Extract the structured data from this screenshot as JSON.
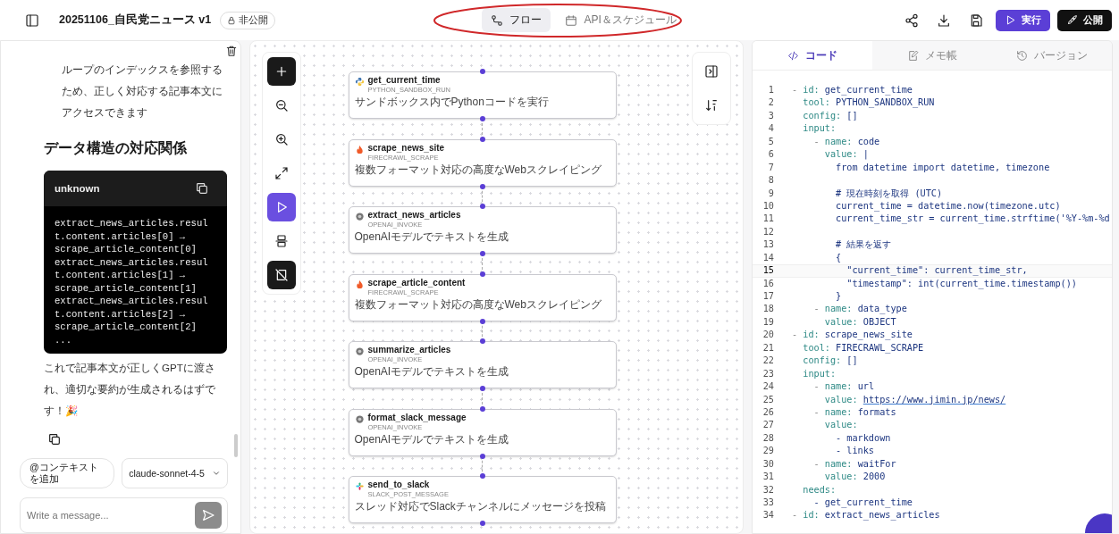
{
  "header": {
    "title": "20251106_自民党ニュース v1",
    "visibility": "非公開",
    "view_tabs": [
      {
        "label": "フロー",
        "kind": "flow",
        "selected": true
      },
      {
        "label": "API＆スケジュール",
        "kind": "calendar",
        "selected": false
      }
    ],
    "run_button": "実行",
    "publish_button": "公開"
  },
  "annotation": {
    "kind": "ellipse"
  },
  "chat": {
    "messages": [
      {
        "kind": "indented",
        "text": "ループのインデックスを参照するため、正しく対応する記事本文にアクセスできます"
      },
      {
        "kind": "heading",
        "text": "データ構造の対応関係"
      },
      {
        "kind": "code",
        "language": "unknown",
        "lines": [
          "extract_news_articles.result.content.articles[0] → scrape_article_content[0]",
          "extract_news_articles.result.content.articles[1] → scrape_article_content[1]",
          "extract_news_articles.result.content.articles[2] → scrape_article_content[2]",
          "..."
        ]
      },
      {
        "kind": "paragraph",
        "text": "これで記事本文が正しくGPTに渡され、適切な要約が生成されるはずです！🎉"
      }
    ],
    "context_button": "@コンテキストを追加",
    "model": "claude-sonnet-4-5",
    "message_placeholder": "Write a message..."
  },
  "canvas": {
    "tools": [
      {
        "kind": "add"
      },
      {
        "kind": "zoom-out"
      },
      {
        "kind": "zoom-in"
      },
      {
        "kind": "fit"
      },
      {
        "kind": "run"
      },
      {
        "kind": "layout"
      },
      {
        "kind": "hide"
      }
    ],
    "nodes": [
      {
        "name": "get_current_time",
        "tool": "PYTHON_SANDBOX_RUN",
        "description": "サンドボックス内でPythonコードを実行",
        "kind": "python"
      },
      {
        "name": "scrape_news_site",
        "tool": "FIRECRAWL_SCRAPE",
        "description": "複数フォーマット対応の高度なWebスクレイピング",
        "kind": "firecrawl"
      },
      {
        "name": "extract_news_articles",
        "tool": "OPENAI_INVOKE",
        "description": "OpenAIモデルでテキストを生成",
        "kind": "openai"
      },
      {
        "name": "scrape_article_content",
        "tool": "FIRECRAWL_SCRAPE",
        "description": "複数フォーマット対応の高度なWebスクレイピング",
        "kind": "firecrawl"
      },
      {
        "name": "summarize_articles",
        "tool": "OPENAI_INVOKE",
        "description": "OpenAIモデルでテキストを生成",
        "kind": "openai"
      },
      {
        "name": "format_slack_message",
        "tool": "OPENAI_INVOKE",
        "description": "OpenAIモデルでテキストを生成",
        "kind": "openai"
      },
      {
        "name": "send_to_slack",
        "tool": "SLACK_POST_MESSAGE",
        "description": "スレッド対応でSlackチャンネルにメッセージを投稿",
        "kind": "slack"
      }
    ]
  },
  "editor": {
    "tabs": [
      {
        "label": "コード",
        "kind": "code",
        "selected": true
      },
      {
        "label": "メモ帳",
        "kind": "notes",
        "selected": false
      },
      {
        "label": "バージョン",
        "kind": "history",
        "selected": false
      }
    ],
    "lines": [
      {
        "n": "1",
        "text": "- id: get_current_time"
      },
      {
        "n": "2",
        "text": "  tool: PYTHON_SANDBOX_RUN"
      },
      {
        "n": "3",
        "text": "  config: []"
      },
      {
        "n": "4",
        "text": "  input:"
      },
      {
        "n": "5",
        "text": "    - name: code"
      },
      {
        "n": "6",
        "text": "      value: |"
      },
      {
        "n": "7",
        "text": "        from datetime import datetime, timezone"
      },
      {
        "n": "8"
      },
      {
        "n": "9",
        "text": "        # 現在時刻を取得 (UTC)"
      },
      {
        "n": "10",
        "text": "        current_time = datetime.now(timezone.utc)"
      },
      {
        "n": "11",
        "text": "        current_time_str = current_time.strftime('%Y-%m-%d"
      },
      {
        "n": "12"
      },
      {
        "n": "13",
        "text": "        # 結果を返す"
      },
      {
        "n": "14",
        "text": "        {"
      },
      {
        "n": "15",
        "text": "          \"current_time\": current_time_str,",
        "active": true
      },
      {
        "n": "16",
        "text": "          \"timestamp\": int(current_time.timestamp())"
      },
      {
        "n": "17",
        "text": "        }"
      },
      {
        "n": "18",
        "text": "    - name: data_type"
      },
      {
        "n": "19",
        "text": "      value: OBJECT"
      },
      {
        "n": "20",
        "text": "- id: scrape_news_site"
      },
      {
        "n": "21",
        "text": "  tool: FIRECRAWL_SCRAPE"
      },
      {
        "n": "22",
        "text": "  config: []"
      },
      {
        "n": "23",
        "text": "  input:"
      },
      {
        "n": "24",
        "text": "    - name: url"
      },
      {
        "n": "25",
        "text": "      value: ",
        "link": "https://www.jimin.jp/news/"
      },
      {
        "n": "26",
        "text": "    - name: formats"
      },
      {
        "n": "27",
        "text": "      value:"
      },
      {
        "n": "28",
        "text": "        - markdown"
      },
      {
        "n": "29",
        "text": "        - links"
      },
      {
        "n": "30",
        "text": "    - name: waitFor"
      },
      {
        "n": "31",
        "text": "      value: 2000"
      },
      {
        "n": "32",
        "text": "  needs:"
      },
      {
        "n": "33",
        "text": "    - get_current_time"
      },
      {
        "n": "34",
        "text": "- id: extract_news_articles"
      }
    ]
  }
}
